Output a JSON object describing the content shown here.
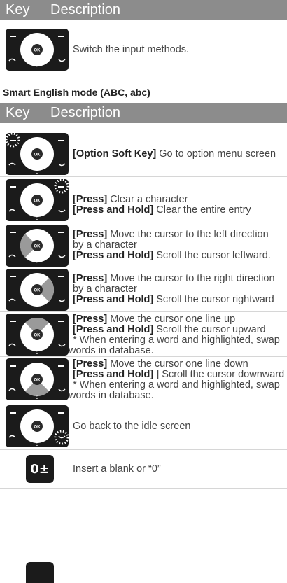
{
  "table1": {
    "header": {
      "key": "Key",
      "description": "Description"
    },
    "rows": [
      {
        "lines": [
          {
            "text": "Switch the input methods."
          }
        ]
      }
    ]
  },
  "section_title": "Smart English mode (ABC, abc)",
  "table2": {
    "header": {
      "key": "Key",
      "description": "Description"
    },
    "rows": [
      {
        "lines": [
          {
            "bold": "[Option Soft Key]",
            "text": " Go to option menu screen"
          }
        ]
      },
      {
        "lines": [
          {
            "bold": "[Press]",
            "text": " Clear a character"
          },
          {
            "bold": "[Press and Hold]",
            "text": " Clear the entire entry"
          }
        ]
      },
      {
        "lines": [
          {
            "bold": "[Press]",
            "text": " Move the cursor to the left direction"
          },
          {
            "text": "by a character"
          },
          {
            "bold": "[Press and Hold]",
            "text": " Scroll the cursor leftward."
          }
        ]
      },
      {
        "lines": [
          {
            "bold": "[Press]",
            "text": " Move the cursor to the right direction"
          },
          {
            "text": "by a character"
          },
          {
            "bold": "[Press and Hold]",
            "text": " Scroll the cursor rightward"
          }
        ]
      },
      {
        "lines": [
          {
            "bold": "[Press]",
            "text": " Move the cursor one line up"
          },
          {
            "bold": "[Press and Hold]",
            "text": " Scroll the cursor upward"
          },
          {
            "text": "* When entering a word and highlighted, swap"
          },
          {
            "text": "words in database."
          }
        ]
      },
      {
        "lines": [
          {
            "bold": "[Press]",
            "text": " Move the cursor one line down"
          },
          {
            "bold": "[Press and Hold]",
            "text": " ] Scroll the cursor downward"
          },
          {
            "text": "* When entering a word and highlighted, swap"
          },
          {
            "text": "words in database."
          }
        ]
      },
      {
        "lines": [
          {
            "text": "Go back to the idle screen"
          }
        ]
      },
      {
        "key_label": "0±",
        "lines": [
          {
            "text": "Insert a blank or “0”"
          }
        ]
      }
    ]
  },
  "key_center_label": "OK",
  "key_bottom_label": "C",
  "colors": {
    "header_bg": "#8c8c8c",
    "keypad": "#1b1b1b",
    "highlight": "#9a9a9a"
  },
  "icons": [
    "phone-keypad-icon",
    "dotted-circle-highlight-icon",
    "zero-plus-key-icon"
  ]
}
